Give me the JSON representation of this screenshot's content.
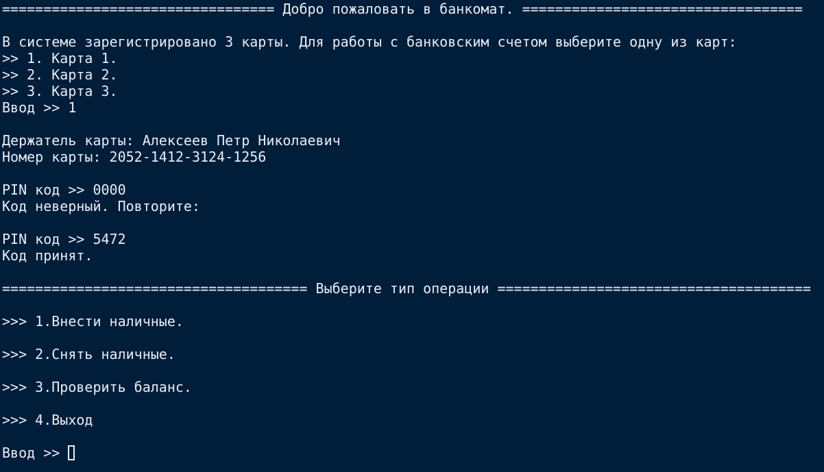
{
  "terminal": {
    "welcome_banner": "================================= Добро пожаловать в банкомат. ==================================",
    "cards_intro": "В системе зарегистрировано 3 карты. Для работы с банковским счетом выберите одну из карт:",
    "cards": [
      ">> 1. Карта 1.",
      ">> 2. Карта 2.",
      ">> 3. Карта 3."
    ],
    "card_input": "Ввод >> 1",
    "holder": "Держатель карты: Алексеев Петр Николаевич",
    "card_number": "Номер карты: 2052-1412-3124-1256",
    "pin_attempt_1": "PIN код >> 0000",
    "pin_error": "Код неверный. Повторите:",
    "pin_attempt_2": "PIN код >> 5472",
    "pin_accepted": "Код принят.",
    "operation_banner": "===================================== Выберите тип операции ======================================",
    "operations": [
      ">>> 1.Внести наличные.",
      ">>> 2.Снять наличные.",
      ">>> 3.Проверить баланс.",
      ">>> 4.Выход"
    ],
    "prompt": "Ввод >> "
  }
}
